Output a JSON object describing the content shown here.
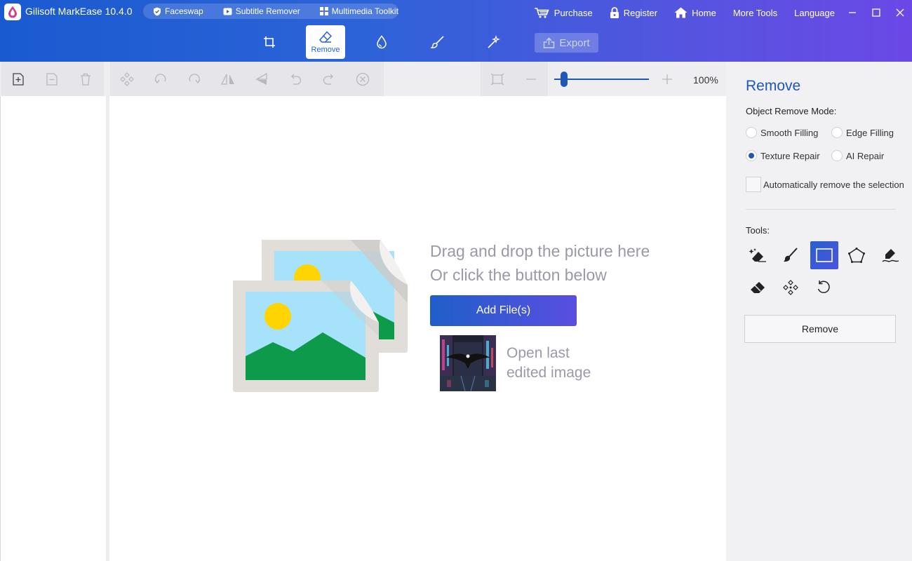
{
  "app": {
    "title": "Gilisoft MarkEase 10.4.0"
  },
  "chips": [
    {
      "label": "Faceswap",
      "icon": "shield-icon"
    },
    {
      "label": "Subtitle Remover",
      "icon": "play-icon"
    },
    {
      "label": "Multimedia Toolkit",
      "icon": "grid-icon"
    }
  ],
  "nav": {
    "purchase": "Purchase",
    "register": "Register",
    "home": "Home",
    "more_tools": "More Tools",
    "language": "Language"
  },
  "modes": {
    "active_label": "Remove",
    "items": [
      "crop-icon",
      "eraser-icon",
      "drop-icon",
      "brush-icon",
      "wand-icon"
    ]
  },
  "export_label": "Export",
  "zoom": {
    "label": "100%",
    "value_fraction": 0.1
  },
  "canvas": {
    "drop_line1": "Drag and drop the picture here",
    "drop_line2": "Or click the button below",
    "add_files": "Add File(s)",
    "open_last_line1": "Open last",
    "open_last_line2": "edited image"
  },
  "panel": {
    "title": "Remove",
    "mode_label": "Object Remove Mode:",
    "modes": [
      {
        "label": "Smooth Filling",
        "checked": false
      },
      {
        "label": "Edge Filling",
        "checked": false
      },
      {
        "label": "Texture Repair",
        "checked": true
      },
      {
        "label": "AI Repair",
        "checked": false
      }
    ],
    "auto_remove": "Automatically remove the selection",
    "tools_label": "Tools:",
    "remove_button": "Remove"
  },
  "colors": {
    "accent": "#1f57b8",
    "title_gradient_start": "#1a5ad0",
    "title_gradient_end": "#6b48e6",
    "muted_text": "#999aa6"
  }
}
